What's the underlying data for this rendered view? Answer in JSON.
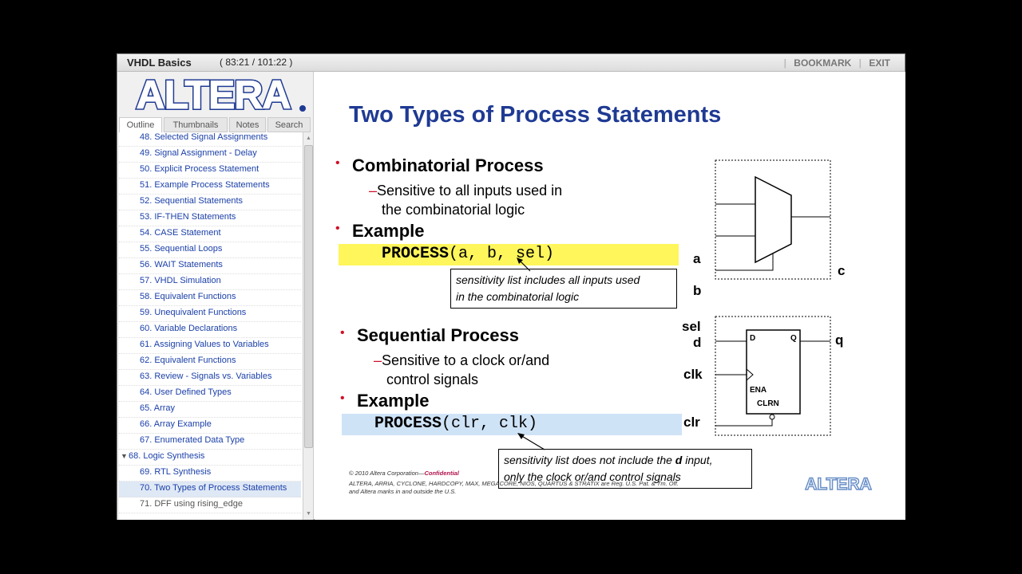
{
  "title": "VHDL Basics",
  "time": "( 83:21 / 101:22 )",
  "header_links": [
    "BOOKMARK",
    "EXIT"
  ],
  "logo": "ALTERA",
  "tabs": [
    "Outline",
    "Thumbnails",
    "Notes",
    "Search"
  ],
  "outline": [
    "48. Selected Signal Assignments",
    "49. Signal Assignment - Delay",
    "50. Explicit Process Statement",
    "51. Example Process Statements",
    "52. Sequential Statements",
    "53. IF-THEN Statements",
    "54. CASE Statement",
    "55. Sequential Loops",
    "56. WAIT Statements",
    "57. VHDL Simulation",
    "58. Equivalent Functions",
    "59. Unequivalent Functions",
    "60. Variable Declarations",
    "61. Assigning Values to Variables",
    "62. Equivalent Functions",
    "63. Review - Signals vs. Variables",
    "64. User Defined Types",
    "65. Array",
    "66. Array Example",
    "67. Enumerated Data Type",
    "68. Logic Synthesis",
    "69. RTL Synthesis",
    "70. Two Types of Process Statements",
    "71. DFF using rising_edge"
  ],
  "selected_item": "70. Two Types of Process Statements",
  "slide": {
    "title": "Two Types of Process Statements",
    "comb": {
      "heading": "Combinatorial Process",
      "sub1": "Sensitive to all inputs used in",
      "sub2": "the combinatorial logic",
      "example": "Example",
      "kw": "PROCESS",
      "args": "(a, b, sel)",
      "note1": "sensitivity list includes all inputs used",
      "note2": "in the combinatorial logic",
      "labels": {
        "a": "a",
        "b": "b",
        "sel": "sel",
        "c": "c"
      }
    },
    "seq": {
      "heading": "Sequential Process",
      "sub1": "Sensitive to a clock or/and",
      "sub2": "control signals",
      "example": "Example",
      "kw": "PROCESS",
      "args": "(clr, clk)",
      "note1a": "sensitivity list does not include the ",
      "note1b": "d",
      "note1c": " input,",
      "note2": "only the clock or/and control signals",
      "labels": {
        "d": "d",
        "clk": "clk",
        "clr": "clr",
        "q": "q",
        "D": "D",
        "Q": "Q",
        "ENA": "ENA",
        "CLRN": "CLRN"
      }
    },
    "footer": {
      "copyright": "© 2010 Altera Corporation—",
      "confidential": "Confidential",
      "line2": "ALTERA, ARRIA, CYCLONE, HARDCOPY, MAX, MEGACORE, NIOS, QUARTUS & STRATIX are Reg. U.S. Pat. & Tm. Off.",
      "line3": "and Altera marks in and outside the U.S."
    },
    "footer_logo": "ALTERA"
  },
  "colors": {
    "accent": "#1f3a93",
    "bullet": "#d0102a",
    "highlight_yellow": "#fef65b",
    "highlight_blue": "#cfe3f7",
    "link": "#1a3fa8"
  }
}
